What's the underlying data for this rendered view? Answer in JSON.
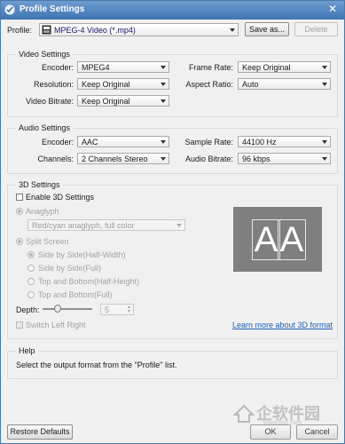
{
  "window": {
    "title": "Profile Settings",
    "close_glyph": "✕"
  },
  "profile": {
    "label": "Profile:",
    "value": "MPEG-4 Video (*.mp4)",
    "icon": "mp4-file-icon",
    "save_as": "Save as...",
    "delete": "Delete"
  },
  "video": {
    "title": "Video Settings",
    "encoder": {
      "label": "Encoder:",
      "value": "MPEG4"
    },
    "frame_rate": {
      "label": "Frame Rate:",
      "value": "Keep Original"
    },
    "resolution": {
      "label": "Resolution:",
      "value": "Keep Original"
    },
    "aspect_ratio": {
      "label": "Aspect Ratio:",
      "value": "Auto"
    },
    "video_bitrate": {
      "label": "Video Bitrate:",
      "value": "Keep Original"
    }
  },
  "audio": {
    "title": "Audio Settings",
    "encoder": {
      "label": "Encoder:",
      "value": "AAC"
    },
    "sample_rate": {
      "label": "Sample Rate:",
      "value": "44100 Hz"
    },
    "channels": {
      "label": "Channels:",
      "value": "2 Channels Stereo"
    },
    "audio_bitrate": {
      "label": "Audio Bitrate:",
      "value": "96 kbps"
    }
  },
  "threed": {
    "title": "3D Settings",
    "enable": "Enable 3D Settings",
    "anaglyph": "Anaglyph",
    "anaglyph_option": "Red/cyan anaglyph, full color",
    "split_screen": "Split Screen",
    "options": [
      "Side by Side(Half-Width)",
      "Side by Side(Full)",
      "Top and Bottom(Half-Height)",
      "Top and Bottom(Full)"
    ],
    "depth_label": "Depth:",
    "depth_value": "5",
    "switch": "Switch Left Right",
    "learn_more": "Learn more about 3D format",
    "preview_text": [
      "A",
      "A"
    ]
  },
  "help": {
    "title": "Help",
    "text": "Select the output format from the \"Profile\" list."
  },
  "footer": {
    "restore": "Restore Defaults",
    "ok": "OK",
    "cancel": "Cancel"
  },
  "watermark": {
    "text": "企软件园",
    "url": "www.pc6.com"
  },
  "colors": {
    "titlebar": "#3f74b3",
    "link": "#1f5fb8",
    "preview_bg": "#7f7f7f"
  }
}
